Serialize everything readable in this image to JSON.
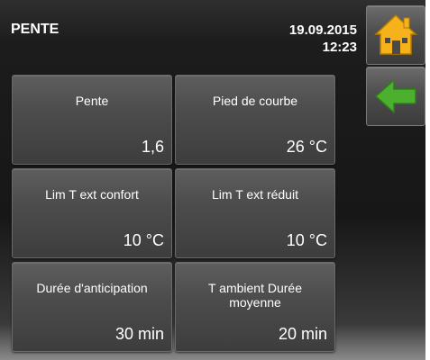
{
  "header": {
    "title": "PENTE",
    "date": "19.09.2015",
    "time": "12:23"
  },
  "nav": {
    "home_icon": "home-icon",
    "back_icon": "back-arrow-icon",
    "home_color": "#f6b21a",
    "back_color": "#4caf2d"
  },
  "tiles": [
    {
      "label": "Pente",
      "value": "1,6"
    },
    {
      "label": "Pied de courbe",
      "value": "26 °C"
    },
    {
      "label": "Lim T ext confort",
      "value": "10 °C"
    },
    {
      "label": "Lim T ext réduit",
      "value": "10 °C"
    },
    {
      "label": "Durée d'anticipation",
      "value": "30 min"
    },
    {
      "label": "T ambient Durée moyenne",
      "value": "20 min"
    }
  ]
}
